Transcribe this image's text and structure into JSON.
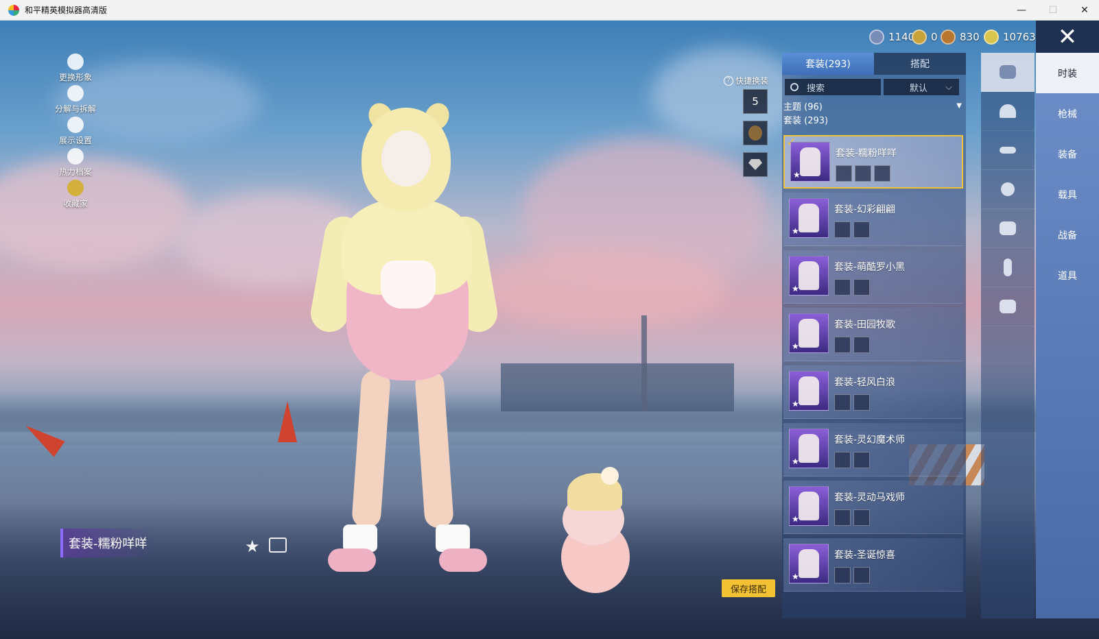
{
  "window": {
    "title": "和平精英模拟器高清版",
    "controls": {
      "minimize": "—",
      "maximize": "☐",
      "close": "✕"
    }
  },
  "currency": [
    {
      "value": "1140",
      "color": "#7a8db8"
    },
    {
      "value": "0",
      "color": "#c9a23a"
    },
    {
      "value": "830",
      "color": "#b7752d"
    },
    {
      "value": "10763",
      "color": "#d9c44c"
    }
  ],
  "left_menu": [
    {
      "label": "更换形象",
      "icon": "person-icon"
    },
    {
      "label": "分解与拆解",
      "icon": "puzzle-icon"
    },
    {
      "label": "展示设置",
      "icon": "eye-icon"
    },
    {
      "label": "热力档案",
      "icon": "flame-icon"
    },
    {
      "label": "收藏家",
      "icon": "medal-icon"
    }
  ],
  "quick": {
    "label": "快捷换装",
    "help": "?",
    "slot1": "5",
    "icons": [
      "outfit-slot-icon",
      "helmet-lock-icon",
      "diamond-icon"
    ]
  },
  "outfit": {
    "name": "套装-糯粉咩咩",
    "star": "★",
    "save_label": "保存搭配"
  },
  "panel": {
    "tabs": [
      {
        "label": "套装(293)",
        "active": true
      },
      {
        "label": "搭配",
        "active": false
      }
    ],
    "search_placeholder": "搜索",
    "sort_label": "默认",
    "sort_arrow": "⌵",
    "filter_label": "主题 (96)",
    "filter_arrow": "▼",
    "count_label": "套装 (293)",
    "check": "✓",
    "items": [
      {
        "name": "套装-糯粉咩咩",
        "selected": true,
        "sub": 3
      },
      {
        "name": "套装-幻彩翩翩",
        "selected": false,
        "sub": 2
      },
      {
        "name": "套装-萌酷罗小黑",
        "selected": false,
        "sub": 2
      },
      {
        "name": "套装-田园牧歌",
        "selected": false,
        "sub": 2
      },
      {
        "name": "套装-轻风白浪",
        "selected": false,
        "sub": 2
      },
      {
        "name": "套装-灵幻魔术师",
        "selected": false,
        "sub": 2
      },
      {
        "name": "套装-灵动马戏师",
        "selected": false,
        "sub": 2
      },
      {
        "name": "套装-圣诞惊喜",
        "selected": false,
        "sub": 2
      }
    ]
  },
  "category_icons": [
    "outfit-icon",
    "cap-icon",
    "glasses-icon",
    "face-icon",
    "top-icon",
    "pants-icon",
    "gloves-icon"
  ],
  "categories": [
    {
      "label": "时装",
      "active": true
    },
    {
      "label": "枪械",
      "active": false
    },
    {
      "label": "装备",
      "active": false
    },
    {
      "label": "载具",
      "active": false
    },
    {
      "label": "战备",
      "active": false
    },
    {
      "label": "道具",
      "active": false
    }
  ],
  "close_glyph": "✕"
}
